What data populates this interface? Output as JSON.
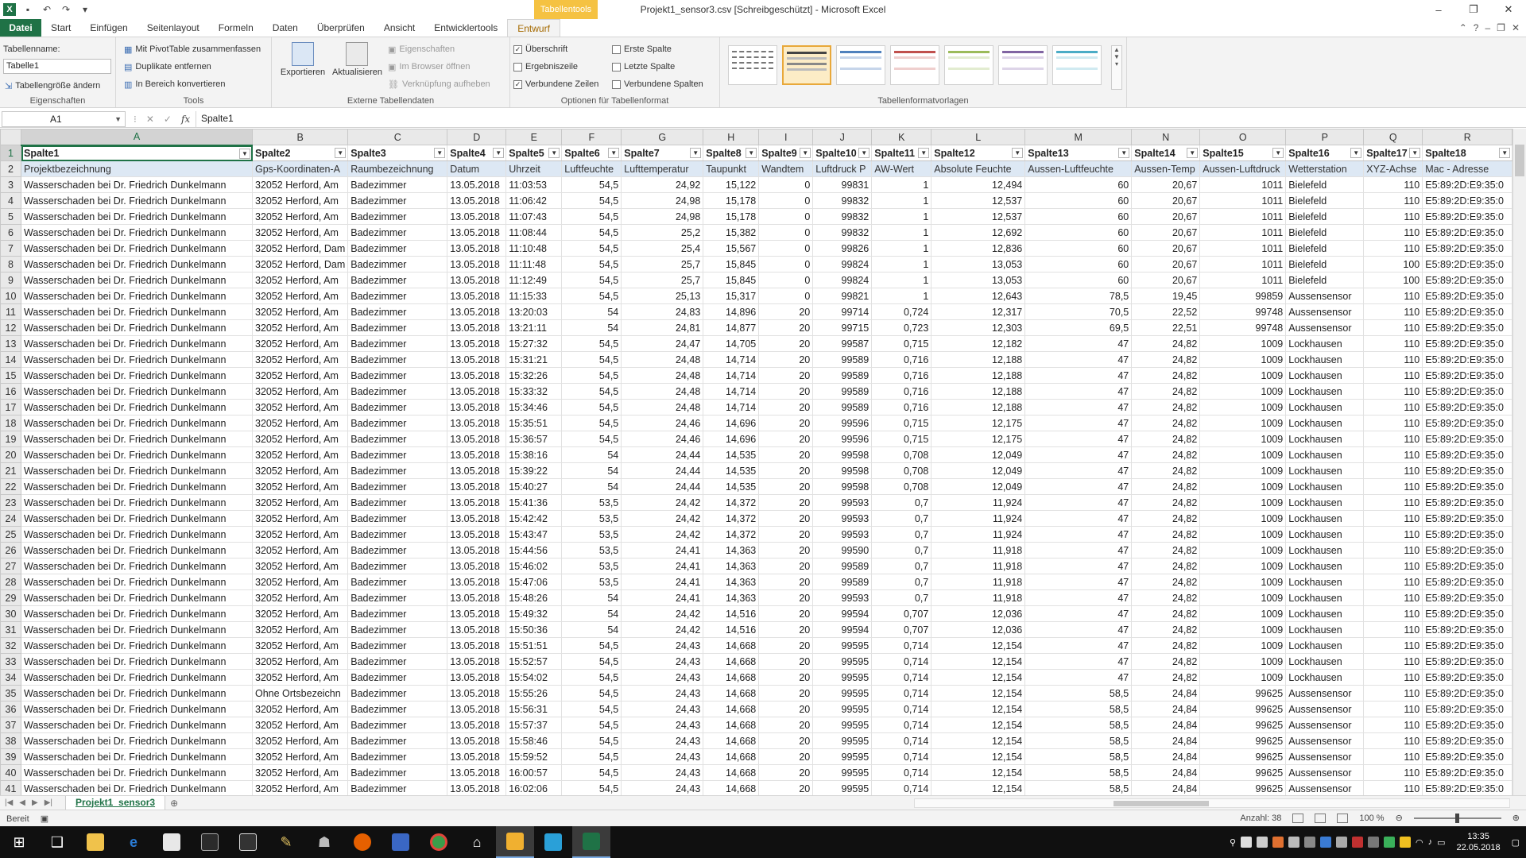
{
  "window": {
    "title": "Projekt1_sensor3.csv  [Schreibgeschützt] - Microsoft Excel",
    "context_tab_title": "Tabellentools",
    "controls": [
      "–",
      "❐",
      "✕"
    ]
  },
  "ribbon_tabs": [
    "Datei",
    "Start",
    "Einfügen",
    "Seitenlayout",
    "Formeln",
    "Daten",
    "Überprüfen",
    "Ansicht",
    "Entwicklertools",
    "Entwurf"
  ],
  "ribbon": {
    "eigenschaften": {
      "table_name_label": "Tabellenname:",
      "table_name_value": "Tabelle1",
      "resize_label": "Tabellengröße ändern",
      "group_label": "Eigenschaften"
    },
    "tools": {
      "pivot": "Mit PivotTable zusammenfassen",
      "dup": "Duplikate entfernen",
      "convert": "In Bereich konvertieren",
      "group_label": "Tools"
    },
    "external": {
      "export": "Exportieren",
      "refresh": "Aktualisieren",
      "props": "Eigenschaften",
      "browser": "Im Browser öffnen",
      "unlink": "Verknüpfung aufheben",
      "group_label": "Externe Tabellendaten"
    },
    "options": {
      "header_row": "Überschrift",
      "total_row": "Ergebniszeile",
      "banded_rows": "Verbundene Zeilen",
      "first_col": "Erste Spalte",
      "last_col": "Letzte Spalte",
      "banded_cols": "Verbundene Spalten",
      "group_label": "Optionen für Tabellenformat"
    },
    "styles": {
      "group_label": "Tabellenformatvorlagen",
      "swatches": [
        "#555555",
        "#444444",
        "#4f81bd",
        "#c0504d",
        "#9bbb59",
        "#8064a2",
        "#4bacc6"
      ]
    }
  },
  "formula_bar": {
    "name_box": "A1",
    "fx": "fx",
    "content": "Spalte1"
  },
  "columns": [
    "A",
    "B",
    "C",
    "D",
    "E",
    "F",
    "G",
    "H",
    "I",
    "J",
    "K",
    "L",
    "M",
    "N",
    "O",
    "P",
    "Q",
    "R"
  ],
  "header_row": [
    "Spalte1",
    "Spalte2",
    "Spalte3",
    "Spalte4",
    "Spalte5",
    "Spalte6",
    "Spalte7",
    "Spalte8",
    "Spalte9",
    "Spalte10",
    "Spalte11",
    "Spalte12",
    "Spalte13",
    "Spalte14",
    "Spalte15",
    "Spalte16",
    "Spalte17",
    "Spalte18"
  ],
  "sub_header_row": [
    "Projektbezeichnung",
    "Gps-Koordinaten-A",
    "Raumbezeichnung",
    "Datum",
    "Uhrzeit",
    "Luftfeuchte",
    "Lufttemperatur",
    "Taupunkt",
    "Wandtem",
    "Luftdruck P",
    "AW-Wert",
    "Absolute Feuchte",
    "Aussen-Luftfeuchte",
    "Aussen-Temp",
    "Aussen-Luftdruck",
    "Wetterstation",
    "XYZ-Achse",
    "Mac - Adresse"
  ],
  "rows": [
    {
      "n": "3",
      "c": [
        "Wasserschaden bei Dr. Friedrich Dunkelmann",
        "32052 Herford, Am",
        "Badezimmer",
        "13.05.2018",
        "11:03:53",
        "54,5",
        "24,92",
        "15,122",
        "0",
        "99831",
        "1",
        "12,494",
        "60",
        "20,67",
        "1011",
        "Bielefeld",
        "110",
        "E5:89:2D:E9:35:0"
      ]
    },
    {
      "n": "4",
      "c": [
        "Wasserschaden bei Dr. Friedrich Dunkelmann",
        "32052 Herford, Am",
        "Badezimmer",
        "13.05.2018",
        "11:06:42",
        "54,5",
        "24,98",
        "15,178",
        "0",
        "99832",
        "1",
        "12,537",
        "60",
        "20,67",
        "1011",
        "Bielefeld",
        "110",
        "E5:89:2D:E9:35:0"
      ]
    },
    {
      "n": "5",
      "c": [
        "Wasserschaden bei Dr. Friedrich Dunkelmann",
        "32052 Herford, Am",
        "Badezimmer",
        "13.05.2018",
        "11:07:43",
        "54,5",
        "24,98",
        "15,178",
        "0",
        "99832",
        "1",
        "12,537",
        "60",
        "20,67",
        "1011",
        "Bielefeld",
        "110",
        "E5:89:2D:E9:35:0"
      ]
    },
    {
      "n": "6",
      "c": [
        "Wasserschaden bei Dr. Friedrich Dunkelmann",
        "32052 Herford, Am",
        "Badezimmer",
        "13.05.2018",
        "11:08:44",
        "54,5",
        "25,2",
        "15,382",
        "0",
        "99832",
        "1",
        "12,692",
        "60",
        "20,67",
        "1011",
        "Bielefeld",
        "110",
        "E5:89:2D:E9:35:0"
      ]
    },
    {
      "n": "7",
      "c": [
        "Wasserschaden bei Dr. Friedrich Dunkelmann",
        "32052 Herford, Dam",
        "Badezimmer",
        "13.05.2018",
        "11:10:48",
        "54,5",
        "25,4",
        "15,567",
        "0",
        "99826",
        "1",
        "12,836",
        "60",
        "20,67",
        "1011",
        "Bielefeld",
        "110",
        "E5:89:2D:E9:35:0"
      ]
    },
    {
      "n": "8",
      "c": [
        "Wasserschaden bei Dr. Friedrich Dunkelmann",
        "32052 Herford, Dam",
        "Badezimmer",
        "13.05.2018",
        "11:11:48",
        "54,5",
        "25,7",
        "15,845",
        "0",
        "99824",
        "1",
        "13,053",
        "60",
        "20,67",
        "1011",
        "Bielefeld",
        "100",
        "E5:89:2D:E9:35:0"
      ]
    },
    {
      "n": "9",
      "c": [
        "Wasserschaden bei Dr. Friedrich Dunkelmann",
        "32052 Herford, Am",
        "Badezimmer",
        "13.05.2018",
        "11:12:49",
        "54,5",
        "25,7",
        "15,845",
        "0",
        "99824",
        "1",
        "13,053",
        "60",
        "20,67",
        "1011",
        "Bielefeld",
        "100",
        "E5:89:2D:E9:35:0"
      ]
    },
    {
      "n": "10",
      "c": [
        "Wasserschaden bei Dr. Friedrich Dunkelmann",
        "32052 Herford, Am",
        "Badezimmer",
        "13.05.2018",
        "11:15:33",
        "54,5",
        "25,13",
        "15,317",
        "0",
        "99821",
        "1",
        "12,643",
        "78,5",
        "19,45",
        "99859",
        "Aussensensor",
        "110",
        "E5:89:2D:E9:35:0"
      ]
    },
    {
      "n": "11",
      "c": [
        "Wasserschaden bei Dr. Friedrich Dunkelmann",
        "32052 Herford, Am",
        "Badezimmer",
        "13.05.2018",
        "13:20:03",
        "54",
        "24,83",
        "14,896",
        "20",
        "99714",
        "0,724",
        "12,317",
        "70,5",
        "22,52",
        "99748",
        "Aussensensor",
        "110",
        "E5:89:2D:E9:35:0"
      ]
    },
    {
      "n": "12",
      "c": [
        "Wasserschaden bei Dr. Friedrich Dunkelmann",
        "32052 Herford, Am",
        "Badezimmer",
        "13.05.2018",
        "13:21:11",
        "54",
        "24,81",
        "14,877",
        "20",
        "99715",
        "0,723",
        "12,303",
        "69,5",
        "22,51",
        "99748",
        "Aussensensor",
        "110",
        "E5:89:2D:E9:35:0"
      ]
    },
    {
      "n": "13",
      "c": [
        "Wasserschaden bei Dr. Friedrich Dunkelmann",
        "32052 Herford, Am",
        "Badezimmer",
        "13.05.2018",
        "15:27:32",
        "54,5",
        "24,47",
        "14,705",
        "20",
        "99587",
        "0,715",
        "12,182",
        "47",
        "24,82",
        "1009",
        "Lockhausen",
        "110",
        "E5:89:2D:E9:35:0"
      ]
    },
    {
      "n": "14",
      "c": [
        "Wasserschaden bei Dr. Friedrich Dunkelmann",
        "32052 Herford, Am",
        "Badezimmer",
        "13.05.2018",
        "15:31:21",
        "54,5",
        "24,48",
        "14,714",
        "20",
        "99589",
        "0,716",
        "12,188",
        "47",
        "24,82",
        "1009",
        "Lockhausen",
        "110",
        "E5:89:2D:E9:35:0"
      ]
    },
    {
      "n": "15",
      "c": [
        "Wasserschaden bei Dr. Friedrich Dunkelmann",
        "32052 Herford, Am",
        "Badezimmer",
        "13.05.2018",
        "15:32:26",
        "54,5",
        "24,48",
        "14,714",
        "20",
        "99589",
        "0,716",
        "12,188",
        "47",
        "24,82",
        "1009",
        "Lockhausen",
        "110",
        "E5:89:2D:E9:35:0"
      ]
    },
    {
      "n": "16",
      "c": [
        "Wasserschaden bei Dr. Friedrich Dunkelmann",
        "32052 Herford, Am",
        "Badezimmer",
        "13.05.2018",
        "15:33:32",
        "54,5",
        "24,48",
        "14,714",
        "20",
        "99589",
        "0,716",
        "12,188",
        "47",
        "24,82",
        "1009",
        "Lockhausen",
        "110",
        "E5:89:2D:E9:35:0"
      ]
    },
    {
      "n": "17",
      "c": [
        "Wasserschaden bei Dr. Friedrich Dunkelmann",
        "32052 Herford, Am",
        "Badezimmer",
        "13.05.2018",
        "15:34:46",
        "54,5",
        "24,48",
        "14,714",
        "20",
        "99589",
        "0,716",
        "12,188",
        "47",
        "24,82",
        "1009",
        "Lockhausen",
        "110",
        "E5:89:2D:E9:35:0"
      ]
    },
    {
      "n": "18",
      "c": [
        "Wasserschaden bei Dr. Friedrich Dunkelmann",
        "32052 Herford, Am",
        "Badezimmer",
        "13.05.2018",
        "15:35:51",
        "54,5",
        "24,46",
        "14,696",
        "20",
        "99596",
        "0,715",
        "12,175",
        "47",
        "24,82",
        "1009",
        "Lockhausen",
        "110",
        "E5:89:2D:E9:35:0"
      ]
    },
    {
      "n": "19",
      "c": [
        "Wasserschaden bei Dr. Friedrich Dunkelmann",
        "32052 Herford, Am",
        "Badezimmer",
        "13.05.2018",
        "15:36:57",
        "54,5",
        "24,46",
        "14,696",
        "20",
        "99596",
        "0,715",
        "12,175",
        "47",
        "24,82",
        "1009",
        "Lockhausen",
        "110",
        "E5:89:2D:E9:35:0"
      ]
    },
    {
      "n": "20",
      "c": [
        "Wasserschaden bei Dr. Friedrich Dunkelmann",
        "32052 Herford, Am",
        "Badezimmer",
        "13.05.2018",
        "15:38:16",
        "54",
        "24,44",
        "14,535",
        "20",
        "99598",
        "0,708",
        "12,049",
        "47",
        "24,82",
        "1009",
        "Lockhausen",
        "110",
        "E5:89:2D:E9:35:0"
      ]
    },
    {
      "n": "21",
      "c": [
        "Wasserschaden bei Dr. Friedrich Dunkelmann",
        "32052 Herford, Am",
        "Badezimmer",
        "13.05.2018",
        "15:39:22",
        "54",
        "24,44",
        "14,535",
        "20",
        "99598",
        "0,708",
        "12,049",
        "47",
        "24,82",
        "1009",
        "Lockhausen",
        "110",
        "E5:89:2D:E9:35:0"
      ]
    },
    {
      "n": "22",
      "c": [
        "Wasserschaden bei Dr. Friedrich Dunkelmann",
        "32052 Herford, Am",
        "Badezimmer",
        "13.05.2018",
        "15:40:27",
        "54",
        "24,44",
        "14,535",
        "20",
        "99598",
        "0,708",
        "12,049",
        "47",
        "24,82",
        "1009",
        "Lockhausen",
        "110",
        "E5:89:2D:E9:35:0"
      ]
    },
    {
      "n": "23",
      "c": [
        "Wasserschaden bei Dr. Friedrich Dunkelmann",
        "32052 Herford, Am",
        "Badezimmer",
        "13.05.2018",
        "15:41:36",
        "53,5",
        "24,42",
        "14,372",
        "20",
        "99593",
        "0,7",
        "11,924",
        "47",
        "24,82",
        "1009",
        "Lockhausen",
        "110",
        "E5:89:2D:E9:35:0"
      ]
    },
    {
      "n": "24",
      "c": [
        "Wasserschaden bei Dr. Friedrich Dunkelmann",
        "32052 Herford, Am",
        "Badezimmer",
        "13.05.2018",
        "15:42:42",
        "53,5",
        "24,42",
        "14,372",
        "20",
        "99593",
        "0,7",
        "11,924",
        "47",
        "24,82",
        "1009",
        "Lockhausen",
        "110",
        "E5:89:2D:E9:35:0"
      ]
    },
    {
      "n": "25",
      "c": [
        "Wasserschaden bei Dr. Friedrich Dunkelmann",
        "32052 Herford, Am",
        "Badezimmer",
        "13.05.2018",
        "15:43:47",
        "53,5",
        "24,42",
        "14,372",
        "20",
        "99593",
        "0,7",
        "11,924",
        "47",
        "24,82",
        "1009",
        "Lockhausen",
        "110",
        "E5:89:2D:E9:35:0"
      ]
    },
    {
      "n": "26",
      "c": [
        "Wasserschaden bei Dr. Friedrich Dunkelmann",
        "32052 Herford, Am",
        "Badezimmer",
        "13.05.2018",
        "15:44:56",
        "53,5",
        "24,41",
        "14,363",
        "20",
        "99590",
        "0,7",
        "11,918",
        "47",
        "24,82",
        "1009",
        "Lockhausen",
        "110",
        "E5:89:2D:E9:35:0"
      ]
    },
    {
      "n": "27",
      "c": [
        "Wasserschaden bei Dr. Friedrich Dunkelmann",
        "32052 Herford, Am",
        "Badezimmer",
        "13.05.2018",
        "15:46:02",
        "53,5",
        "24,41",
        "14,363",
        "20",
        "99589",
        "0,7",
        "11,918",
        "47",
        "24,82",
        "1009",
        "Lockhausen",
        "110",
        "E5:89:2D:E9:35:0"
      ]
    },
    {
      "n": "28",
      "c": [
        "Wasserschaden bei Dr. Friedrich Dunkelmann",
        "32052 Herford, Am",
        "Badezimmer",
        "13.05.2018",
        "15:47:06",
        "53,5",
        "24,41",
        "14,363",
        "20",
        "99589",
        "0,7",
        "11,918",
        "47",
        "24,82",
        "1009",
        "Lockhausen",
        "110",
        "E5:89:2D:E9:35:0"
      ]
    },
    {
      "n": "29",
      "c": [
        "Wasserschaden bei Dr. Friedrich Dunkelmann",
        "32052 Herford, Am",
        "Badezimmer",
        "13.05.2018",
        "15:48:26",
        "54",
        "24,41",
        "14,363",
        "20",
        "99593",
        "0,7",
        "11,918",
        "47",
        "24,82",
        "1009",
        "Lockhausen",
        "110",
        "E5:89:2D:E9:35:0"
      ]
    },
    {
      "n": "30",
      "c": [
        "Wasserschaden bei Dr. Friedrich Dunkelmann",
        "32052 Herford, Am",
        "Badezimmer",
        "13.05.2018",
        "15:49:32",
        "54",
        "24,42",
        "14,516",
        "20",
        "99594",
        "0,707",
        "12,036",
        "47",
        "24,82",
        "1009",
        "Lockhausen",
        "110",
        "E5:89:2D:E9:35:0"
      ]
    },
    {
      "n": "31",
      "c": [
        "Wasserschaden bei Dr. Friedrich Dunkelmann",
        "32052 Herford, Am",
        "Badezimmer",
        "13.05.2018",
        "15:50:36",
        "54",
        "24,42",
        "14,516",
        "20",
        "99594",
        "0,707",
        "12,036",
        "47",
        "24,82",
        "1009",
        "Lockhausen",
        "110",
        "E5:89:2D:E9:35:0"
      ]
    },
    {
      "n": "32",
      "c": [
        "Wasserschaden bei Dr. Friedrich Dunkelmann",
        "32052 Herford, Am",
        "Badezimmer",
        "13.05.2018",
        "15:51:51",
        "54,5",
        "24,43",
        "14,668",
        "20",
        "99595",
        "0,714",
        "12,154",
        "47",
        "24,82",
        "1009",
        "Lockhausen",
        "110",
        "E5:89:2D:E9:35:0"
      ]
    },
    {
      "n": "33",
      "c": [
        "Wasserschaden bei Dr. Friedrich Dunkelmann",
        "32052 Herford, Am",
        "Badezimmer",
        "13.05.2018",
        "15:52:57",
        "54,5",
        "24,43",
        "14,668",
        "20",
        "99595",
        "0,714",
        "12,154",
        "47",
        "24,82",
        "1009",
        "Lockhausen",
        "110",
        "E5:89:2D:E9:35:0"
      ]
    },
    {
      "n": "34",
      "c": [
        "Wasserschaden bei Dr. Friedrich Dunkelmann",
        "32052 Herford, Am",
        "Badezimmer",
        "13.05.2018",
        "15:54:02",
        "54,5",
        "24,43",
        "14,668",
        "20",
        "99595",
        "0,714",
        "12,154",
        "47",
        "24,82",
        "1009",
        "Lockhausen",
        "110",
        "E5:89:2D:E9:35:0"
      ]
    },
    {
      "n": "35",
      "c": [
        "Wasserschaden bei Dr. Friedrich Dunkelmann",
        "Ohne Ortsbezeichn",
        "Badezimmer",
        "13.05.2018",
        "15:55:26",
        "54,5",
        "24,43",
        "14,668",
        "20",
        "99595",
        "0,714",
        "12,154",
        "58,5",
        "24,84",
        "99625",
        "Aussensensor",
        "110",
        "E5:89:2D:E9:35:0"
      ]
    },
    {
      "n": "36",
      "c": [
        "Wasserschaden bei Dr. Friedrich Dunkelmann",
        "32052 Herford, Am",
        "Badezimmer",
        "13.05.2018",
        "15:56:31",
        "54,5",
        "24,43",
        "14,668",
        "20",
        "99595",
        "0,714",
        "12,154",
        "58,5",
        "24,84",
        "99625",
        "Aussensensor",
        "110",
        "E5:89:2D:E9:35:0"
      ]
    },
    {
      "n": "37",
      "c": [
        "Wasserschaden bei Dr. Friedrich Dunkelmann",
        "32052 Herford, Am",
        "Badezimmer",
        "13.05.2018",
        "15:57:37",
        "54,5",
        "24,43",
        "14,668",
        "20",
        "99595",
        "0,714",
        "12,154",
        "58,5",
        "24,84",
        "99625",
        "Aussensensor",
        "110",
        "E5:89:2D:E9:35:0"
      ]
    },
    {
      "n": "38",
      "c": [
        "Wasserschaden bei Dr. Friedrich Dunkelmann",
        "32052 Herford, Am",
        "Badezimmer",
        "13.05.2018",
        "15:58:46",
        "54,5",
        "24,43",
        "14,668",
        "20",
        "99595",
        "0,714",
        "12,154",
        "58,5",
        "24,84",
        "99625",
        "Aussensensor",
        "110",
        "E5:89:2D:E9:35:0"
      ]
    },
    {
      "n": "39",
      "c": [
        "Wasserschaden bei Dr. Friedrich Dunkelmann",
        "32052 Herford, Am",
        "Badezimmer",
        "13.05.2018",
        "15:59:52",
        "54,5",
        "24,43",
        "14,668",
        "20",
        "99595",
        "0,714",
        "12,154",
        "58,5",
        "24,84",
        "99625",
        "Aussensensor",
        "110",
        "E5:89:2D:E9:35:0"
      ]
    },
    {
      "n": "40",
      "c": [
        "Wasserschaden bei Dr. Friedrich Dunkelmann",
        "32052 Herford, Am",
        "Badezimmer",
        "13.05.2018",
        "16:00:57",
        "54,5",
        "24,43",
        "14,668",
        "20",
        "99595",
        "0,714",
        "12,154",
        "58,5",
        "24,84",
        "99625",
        "Aussensensor",
        "110",
        "E5:89:2D:E9:35:0"
      ]
    },
    {
      "n": "41",
      "c": [
        "Wasserschaden bei Dr. Friedrich Dunkelmann",
        "32052 Herford, Am",
        "Badezimmer",
        "13.05.2018",
        "16:02:06",
        "54,5",
        "24,43",
        "14,668",
        "20",
        "99595",
        "0,714",
        "12,154",
        "58,5",
        "24,84",
        "99625",
        "Aussensensor",
        "110",
        "E5:89:2D:E9:35:0"
      ]
    }
  ],
  "sheet_tabs": [
    "Projekt1_sensor3"
  ],
  "status": {
    "ready": "Bereit",
    "count": "Anzahl: 38",
    "zoom": "100 %"
  },
  "taskbar": {
    "time": "13:35",
    "date": "22.05.2018",
    "apps": [
      "start",
      "task-view",
      "explorer",
      "edge",
      "store",
      "lightroom",
      "app-s",
      "pen",
      "cat",
      "firefox",
      "outlook-blue",
      "chrome",
      "home",
      "outlook",
      "app-cyan",
      "excel"
    ]
  }
}
